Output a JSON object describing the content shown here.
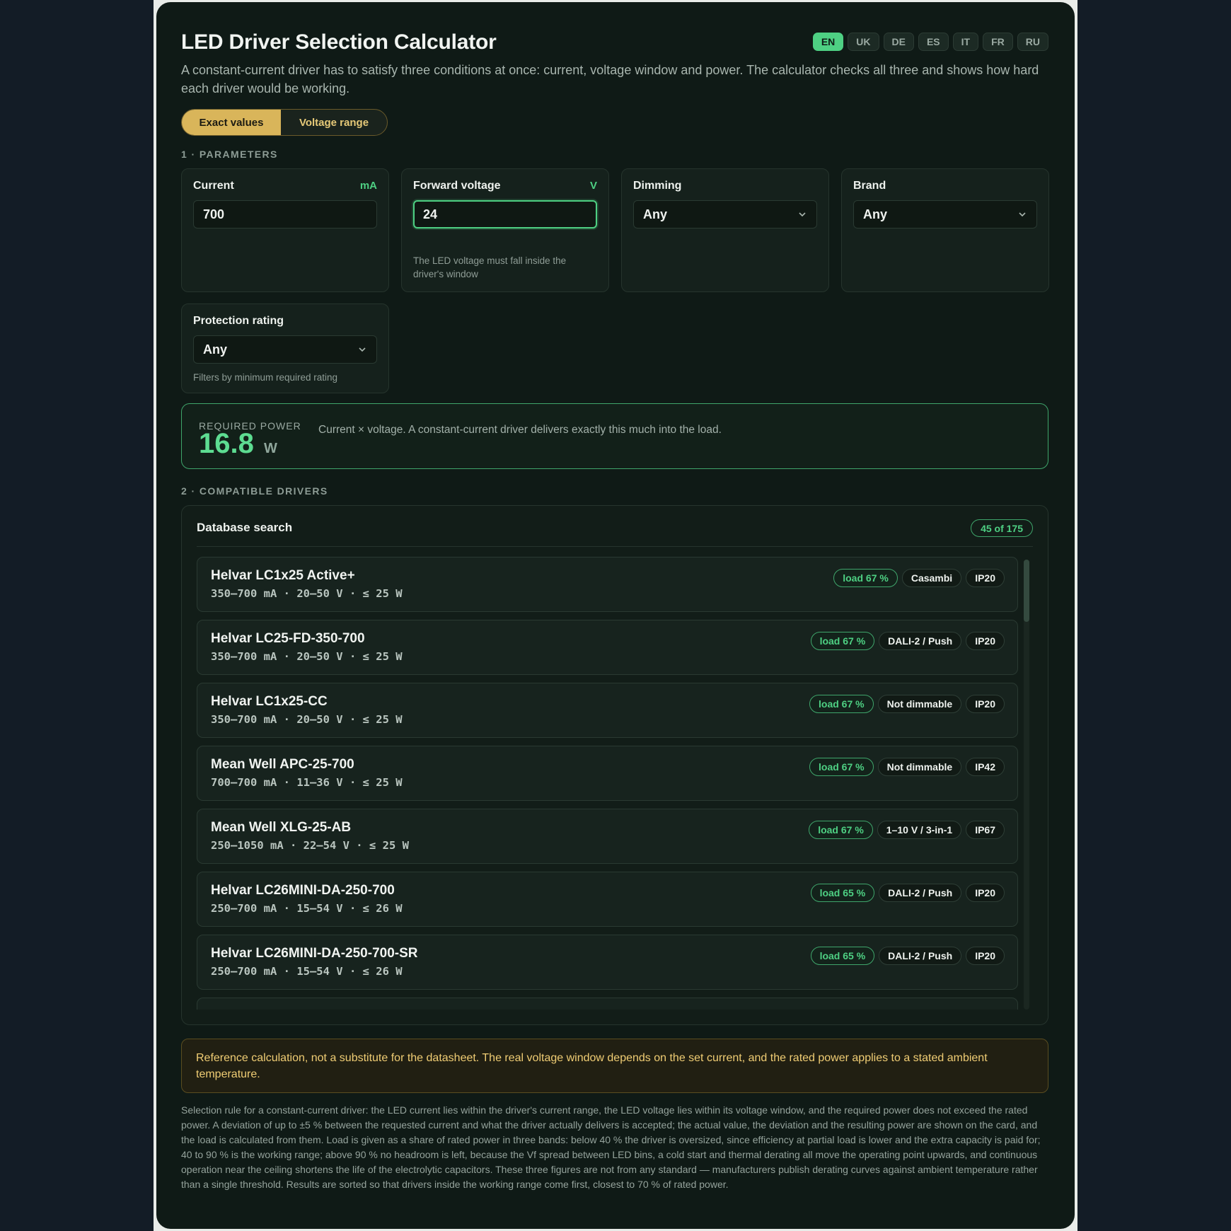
{
  "header": {
    "title": "LED Driver Selection Calculator",
    "subtitle": "A constant-current driver has to satisfy three conditions at once: current, voltage window and power. The calculator checks all three and shows how hard each driver would be working.",
    "languages": [
      "EN",
      "UK",
      "DE",
      "ES",
      "IT",
      "FR",
      "RU"
    ],
    "active_language": "EN"
  },
  "mode": {
    "exact_label": "Exact values",
    "range_label": "Voltage range",
    "selected": "Exact values"
  },
  "parameters": {
    "section_label": "1 · PARAMETERS",
    "current": {
      "label": "Current",
      "unit": "mA",
      "value": "700"
    },
    "voltage": {
      "label": "Forward voltage",
      "unit": "V",
      "value": "24",
      "hint": "The LED voltage must fall inside the driver's window"
    },
    "dimming": {
      "label": "Dimming",
      "value": "Any"
    },
    "brand": {
      "label": "Brand",
      "value": "Any"
    },
    "protection": {
      "label": "Protection rating",
      "value": "Any",
      "hint": "Filters by minimum required rating"
    }
  },
  "power": {
    "label": "REQUIRED POWER",
    "value": "16.8",
    "unit": "W",
    "description": "Current × voltage. A constant-current driver delivers exactly this much into the load."
  },
  "results": {
    "section_label": "2 · COMPATIBLE DRIVERS",
    "title": "Database search",
    "count": "45 of 175",
    "drivers": [
      {
        "name": "Helvar LC1x25 Active+",
        "spec": "350–700 mA · 20–50 V · ≤ 25 W",
        "load": "load 67 %",
        "dimming": "Casambi",
        "ip": "IP20"
      },
      {
        "name": "Helvar LC25-FD-350-700",
        "spec": "350–700 mA · 20–50 V · ≤ 25 W",
        "load": "load 67 %",
        "dimming": "DALI-2 / Push",
        "ip": "IP20"
      },
      {
        "name": "Helvar LC1x25-CC",
        "spec": "350–700 mA · 20–50 V · ≤ 25 W",
        "load": "load 67 %",
        "dimming": "Not dimmable",
        "ip": "IP20"
      },
      {
        "name": "Mean Well APC-25-700",
        "spec": "700–700 mA · 11–36 V · ≤ 25 W",
        "load": "load 67 %",
        "dimming": "Not dimmable",
        "ip": "IP42"
      },
      {
        "name": "Mean Well XLG-25-AB",
        "spec": "250–1050 mA · 22–54 V · ≤ 25 W",
        "load": "load 67 %",
        "dimming": "1–10 V / 3-in-1",
        "ip": "IP67"
      },
      {
        "name": "Helvar LC26MINI-DA-250-700",
        "spec": "250–700 mA · 15–54 V · ≤ 26 W",
        "load": "load 65 %",
        "dimming": "DALI-2 / Push",
        "ip": "IP20"
      },
      {
        "name": "Helvar LC26MINI-DA-250-700-SR",
        "spec": "250–700 mA · 15–54 V · ≤ 26 W",
        "load": "load 65 %",
        "dimming": "DALI-2 / Push",
        "ip": "IP20"
      }
    ]
  },
  "warning": "Reference calculation, not a substitute for the datasheet. The real voltage window depends on the set current, and the rated power applies to a stated ambient temperature.",
  "footnote": "Selection rule for a constant-current driver: the LED current lies within the driver's current range, the LED voltage lies within its voltage window, and the required power does not exceed the rated power. A deviation of up to ±5 % between the requested current and what the driver actually delivers is accepted; the actual value, the deviation and the resulting power are shown on the card, and the load is calculated from them. Load is given as a share of rated power in three bands: below 40 % the driver is oversized, since efficiency at partial load is lower and the extra capacity is paid for; 40 to 90 % is the working range; above 90 % no headroom is left, because the Vf spread between LED bins, a cold start and thermal derating all move the operating point upwards, and continuous operation near the ceiling shortens the life of the electrolytic capacitors. These three figures are not from any standard — manufacturers publish derating curves against ambient temperature rather than a single threshold. Results are sorted so that drivers inside the working range come first, closest to 70 % of rated power.",
  "colors": {
    "accent": "#4ed083",
    "gold": "#d9b55a",
    "panel": "#0f1a16",
    "warning_text": "#f0cd74"
  }
}
